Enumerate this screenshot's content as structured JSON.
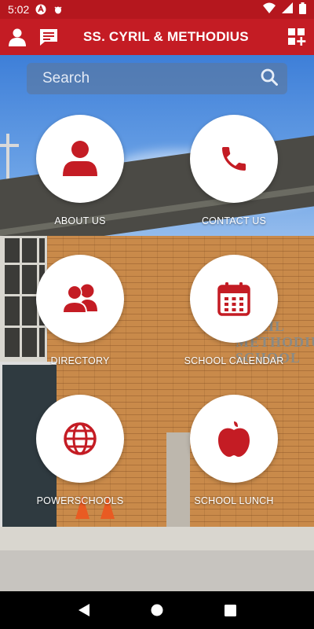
{
  "status": {
    "time": "5:02"
  },
  "app_bar": {
    "title": "SS. CYRIL & METHODIUS"
  },
  "search": {
    "placeholder": "Search"
  },
  "tiles": [
    {
      "label": "ABOUT US",
      "icon": "person-icon"
    },
    {
      "label": "CONTACT US",
      "icon": "phone-icon"
    },
    {
      "label": "DIRECTORY",
      "icon": "group-icon"
    },
    {
      "label": "SCHOOL CALENDAR",
      "icon": "calendar-icon"
    },
    {
      "label": "POWERSCHOOLS",
      "icon": "globe-icon"
    },
    {
      "label": "SCHOOL LUNCH",
      "icon": "apple-icon"
    }
  ],
  "background": {
    "sign_text": "CYRIL\nMETHODIUS\nSCHOOL"
  },
  "colors": {
    "brand_red": "#c41c24",
    "status_red": "#b5171e",
    "icon_red": "#c41c24",
    "tile_bg": "#ffffff"
  }
}
